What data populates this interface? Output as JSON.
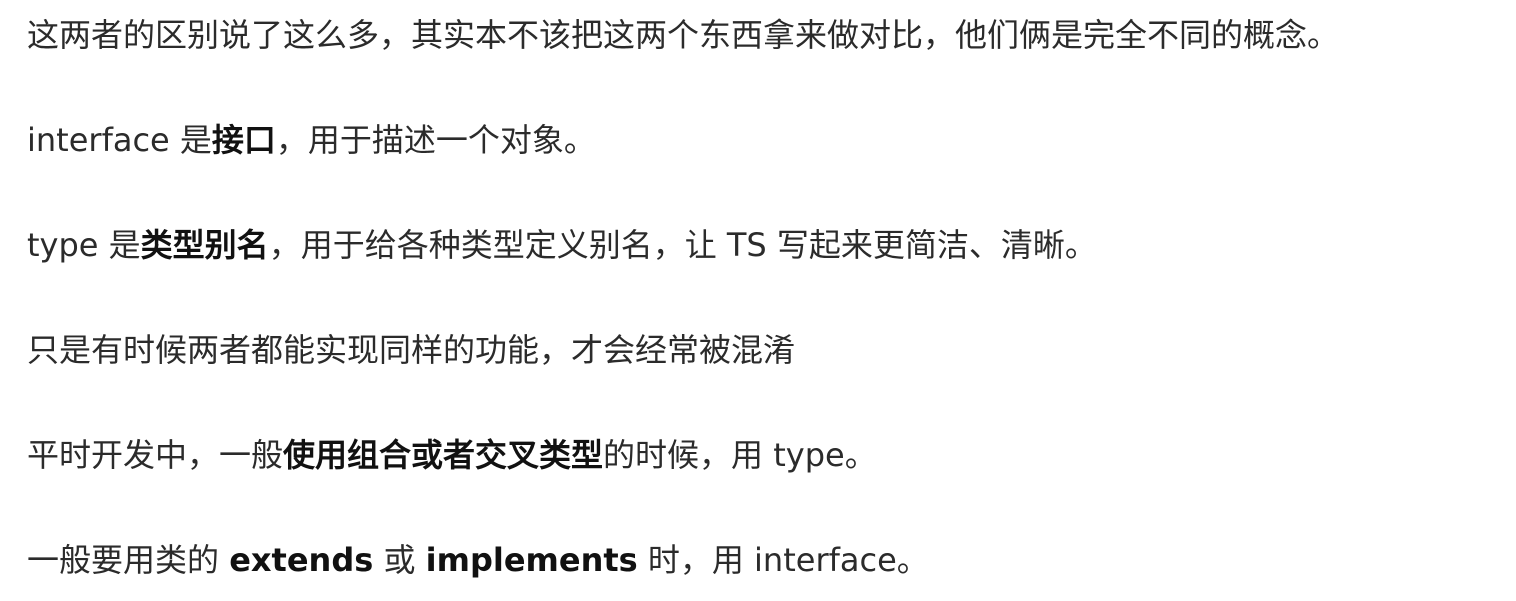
{
  "paragraphs": [
    {
      "segments": [
        {
          "text": "这两者的区别说了这么多，其实本不该把这两个东西拿来做对比，他们俩是完全不同的概念。",
          "bold": false
        }
      ]
    },
    {
      "segments": [
        {
          "text": "interface 是",
          "bold": false
        },
        {
          "text": "接口",
          "bold": true
        },
        {
          "text": "，用于描述一个对象。",
          "bold": false
        }
      ]
    },
    {
      "segments": [
        {
          "text": "type 是",
          "bold": false
        },
        {
          "text": "类型别名",
          "bold": true
        },
        {
          "text": "，用于给各种类型定义别名，让 TS 写起来更简洁、清晰。",
          "bold": false
        }
      ]
    },
    {
      "segments": [
        {
          "text": "只是有时候两者都能实现同样的功能，才会经常被混淆",
          "bold": false
        }
      ]
    },
    {
      "segments": [
        {
          "text": "平时开发中，一般",
          "bold": false
        },
        {
          "text": "使用组合或者交叉类型",
          "bold": true
        },
        {
          "text": "的时候，用 type。",
          "bold": false
        }
      ]
    },
    {
      "segments": [
        {
          "text": "一般要用类的 ",
          "bold": false
        },
        {
          "text": "extends",
          "bold": true
        },
        {
          "text": " 或 ",
          "bold": false
        },
        {
          "text": "implements",
          "bold": true
        },
        {
          "text": " 时，用 interface。",
          "bold": false
        }
      ]
    }
  ]
}
